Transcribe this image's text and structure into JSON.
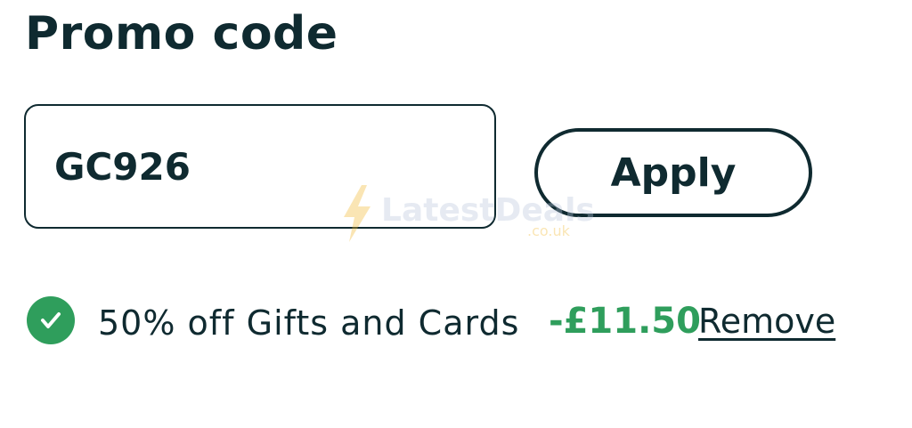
{
  "promo": {
    "title": "Promo code",
    "input_value": "GC926",
    "apply_label": "Apply"
  },
  "applied": {
    "description": "50% off Gifts and Cards",
    "amount": "-£11.50",
    "remove_label": "Remove",
    "status_icon": "check-circle-icon"
  },
  "watermark": {
    "main": "LatestDeals",
    "sub": ".co.uk"
  },
  "colors": {
    "primary": "#0f2a30",
    "success": "#2f9e5c"
  }
}
